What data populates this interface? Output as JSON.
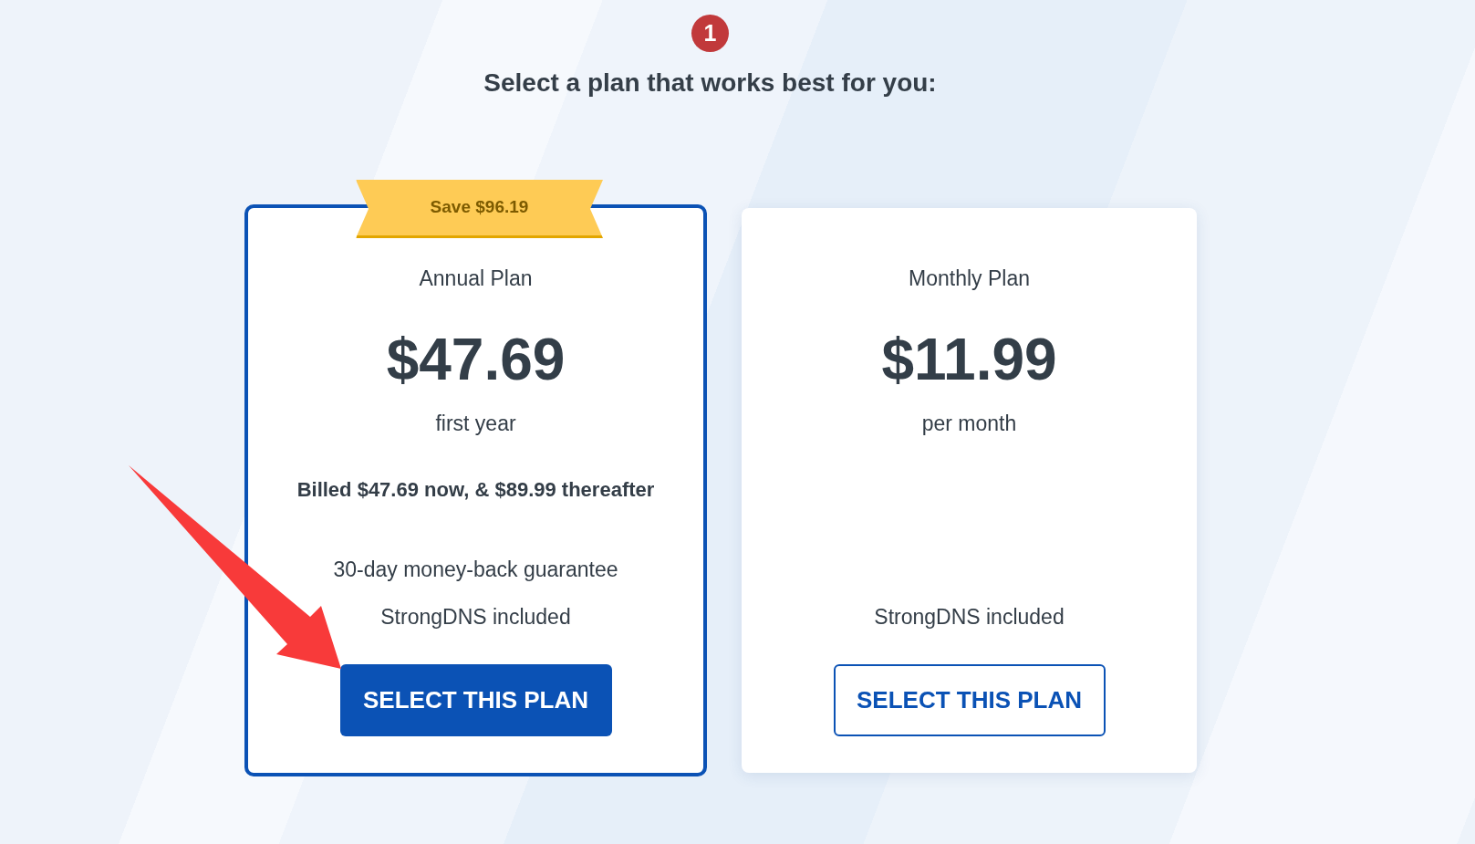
{
  "step": {
    "number": "1",
    "title": "Select a plan that works best for you:"
  },
  "plans": [
    {
      "name": "Annual Plan",
      "selected": true,
      "ribbon": "Save $96.19",
      "price": "$47.69",
      "period": "first year",
      "billing": "Billed $47.69 now, & $89.99 thereafter",
      "features": [
        "30-day money-back guarantee",
        "StrongDNS included"
      ],
      "button": "SELECT THIS PLAN"
    },
    {
      "name": "Monthly Plan",
      "selected": false,
      "price": "$11.99",
      "period": "per month",
      "features": [
        "StrongDNS included"
      ],
      "button": "SELECT THIS PLAN"
    }
  ]
}
